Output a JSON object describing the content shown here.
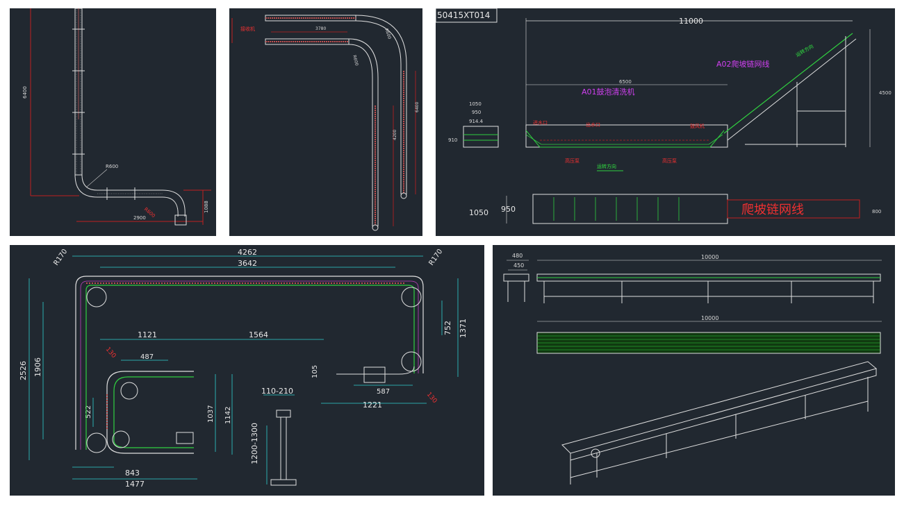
{
  "panel1": {
    "dims": {
      "height_left": "6400",
      "bend_radius": "R600",
      "bend_radius_2": "R600",
      "bottom_len": "2900",
      "right_h": "1088"
    }
  },
  "panel2": {
    "dims": {
      "top_len": "3780",
      "bend_a": "R600",
      "bend_b": "R600",
      "right_h": "6400",
      "mid_h": "4200"
    },
    "label_red": "接收机"
  },
  "panel3": {
    "drawing_no": "50415XT014",
    "dims": {
      "total_len": "11000",
      "washer_len": "6500",
      "d1050": "1050",
      "d950": "950",
      "d914": "914.4",
      "d910": "910",
      "height_right": "4500",
      "plan_1050": "1050",
      "plan_950": "950",
      "plan_800": "800"
    },
    "labels": {
      "a01": "A01鼓泡清洗机",
      "a02": "A02爬坡链网线",
      "plan_title": "爬坡链网线",
      "run_dir": "运转方向",
      "run_dir_2": "运转方向",
      "inlet": "进水口",
      "outlet": "出水口",
      "pump": "高压泵",
      "pump_2": "高压泵",
      "blower": "鼓风机"
    }
  },
  "panel4": {
    "dims": {
      "r_left": "R170",
      "r_right": "R170",
      "top_outer": "4262",
      "top_inner": "3642",
      "left_outer": "2526",
      "left_inner": "1906",
      "right_outer": "1371",
      "right_inner": "752",
      "d1121": "1121",
      "d1564": "1564",
      "d487": "487",
      "d105": "105",
      "d587": "587",
      "d1221": "1221",
      "d1037": "1037",
      "d1142": "1142",
      "d522": "522",
      "d843": "843",
      "d1477": "1477",
      "d110_210": "110-210",
      "d1200_1300": "1200-1300",
      "d130a": "130",
      "d130b": "130"
    }
  },
  "panel5": {
    "dims": {
      "w480": "480",
      "w450": "450",
      "len_top": "10000",
      "len_plan": "10000"
    }
  }
}
